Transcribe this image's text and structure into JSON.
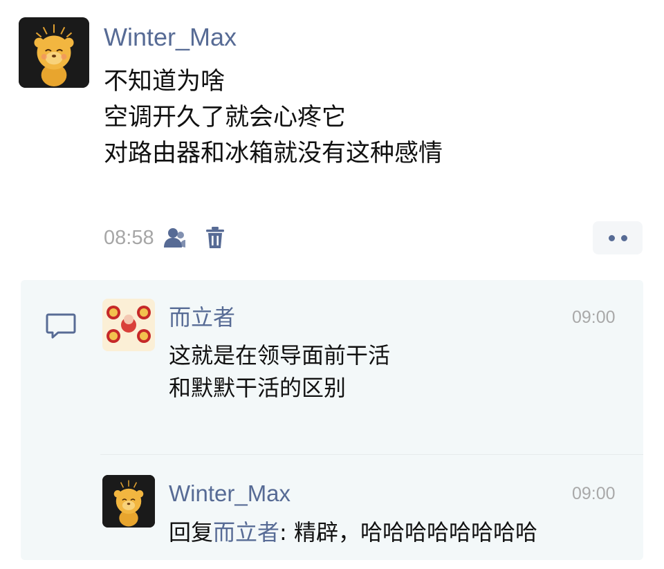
{
  "post": {
    "author": "Winter_Max",
    "lines": [
      "不知道为啥",
      "空调开久了就会心疼它",
      "对路由器和冰箱就没有这种感情"
    ],
    "time": "08:58",
    "icons": [
      "friends-visible-icon",
      "delete-icon"
    ],
    "more_icon": "more-dots-icon"
  },
  "comments": [
    {
      "author": "而立者",
      "time": "09:00",
      "lines": [
        "这就是在领导面前干活",
        "和默默干活的区别"
      ]
    },
    {
      "author": "Winter_Max",
      "time": "09:00",
      "reply_prefix": "回复",
      "reply_to": "而立者",
      "reply_text": ": 精辟，哈哈哈哈哈哈哈哈"
    }
  ],
  "colors": {
    "link": "#576b95",
    "text": "#111111",
    "muted": "#a6a6a6",
    "comment_bg": "#f3f8f9"
  }
}
